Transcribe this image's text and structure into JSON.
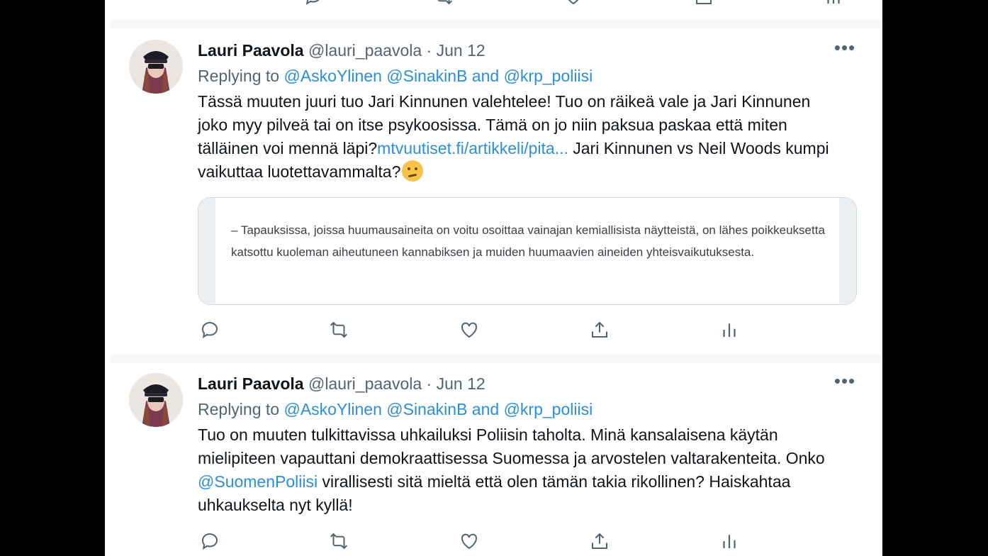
{
  "colors": {
    "link": "#2b8fd6",
    "text": "#0f1419",
    "muted": "#536471",
    "separator": "#f7f9f9"
  },
  "tweets": [
    {
      "name": "Lauri Paavola",
      "handle": "@lauri_paavola",
      "dot": "·",
      "date": "Jun 12",
      "more": "•••",
      "replying_prefix": "Replying to",
      "mention1": "@AskoYlinen",
      "mention2": "@SinakinB",
      "and": "and",
      "mention3": "@krp_poliisi",
      "text_part1": "Tässä muuten juuri tuo Jari Kinnunen valehtelee! Tuo on räikeä vale ja Jari Kinnunen joko myy pilveä tai on itse psykoosissa. Tämä on jo niin paksua paskaa että miten tälläinen voi mennä läpi?",
      "link": "mtvuutiset.fi/artikkeli/pita...",
      "text_part2": " Jari Kinnunen vs Neil Woods kumpi vaikuttaa luotettavammalta?",
      "emoji": "thinking-face",
      "card_text": "– Tapauksissa, joissa huumausaineita on voitu osoittaa vainajan kemiallisista näytteistä, on lähes poikkeuksetta katsottu kuoleman aiheutuneen kannabiksen ja muiden huumaavien aineiden yhteisvaikutuksesta."
    },
    {
      "name": "Lauri Paavola",
      "handle": "@lauri_paavola",
      "dot": "·",
      "date": "Jun 12",
      "more": "•••",
      "replying_prefix": "Replying to",
      "mention1": "@AskoYlinen",
      "mention2": "@SinakinB",
      "and": "and",
      "mention3": "@krp_poliisi",
      "text_part1": "Tuo on muuten tulkittavissa uhkailuksi Poliisin taholta. Minä kansalaisena käytän mielipiteen vapauttani demokraattisessa Suomessa ja arvostelen valtarakenteita. Onko ",
      "mention_inline": "@SuomenPoliisi",
      "text_part2": " virallisesti sitä mieltä että olen tämän takia rikollinen? Haiskahtaa uhkaukselta nyt kyllä!"
    }
  ],
  "action_icons": [
    "reply-icon",
    "retweet-icon",
    "like-icon",
    "share-icon",
    "analytics-icon"
  ]
}
